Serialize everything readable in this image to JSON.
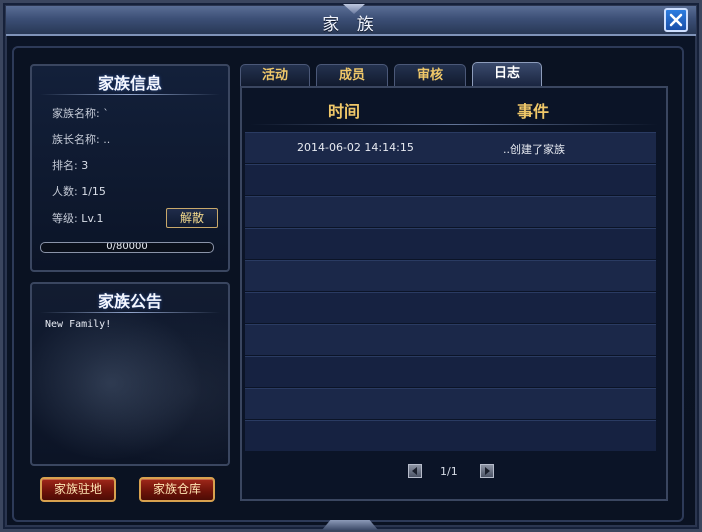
{
  "window": {
    "title": "家 族",
    "close_icon": "close-x-icon"
  },
  "info": {
    "title": "家族信息",
    "name_label": "家族名称: `",
    "leader_label": "族长名称: ..",
    "rank_label": "排名: ",
    "rank_value": "3",
    "members_label": "人数: ",
    "members_value": "1/15",
    "level_label": "等级: ",
    "level_value": "Lv.1",
    "disband_label": "解散",
    "progress_text": "0/80000",
    "progress_fraction": 0
  },
  "notice": {
    "title": "家族公告",
    "text": "New Family!"
  },
  "buttons": {
    "residence": "家族驻地",
    "warehouse": "家族仓库"
  },
  "tabs": [
    {
      "label": "活动",
      "active": false
    },
    {
      "label": "成员",
      "active": false
    },
    {
      "label": "审核",
      "active": false
    },
    {
      "label": "日志",
      "active": true
    }
  ],
  "log": {
    "header_time": "时间",
    "header_event": "事件",
    "rows": [
      {
        "time": "2014-06-02 14:14:15",
        "event": "..创建了家族"
      },
      {
        "time": "",
        "event": ""
      },
      {
        "time": "",
        "event": ""
      },
      {
        "time": "",
        "event": ""
      },
      {
        "time": "",
        "event": ""
      },
      {
        "time": "",
        "event": ""
      },
      {
        "time": "",
        "event": ""
      },
      {
        "time": "",
        "event": ""
      },
      {
        "time": "",
        "event": ""
      },
      {
        "time": "",
        "event": ""
      }
    ]
  },
  "pager": {
    "text": "1/1",
    "prev_icon": "triangle-left-icon",
    "next_icon": "triangle-right-icon"
  }
}
